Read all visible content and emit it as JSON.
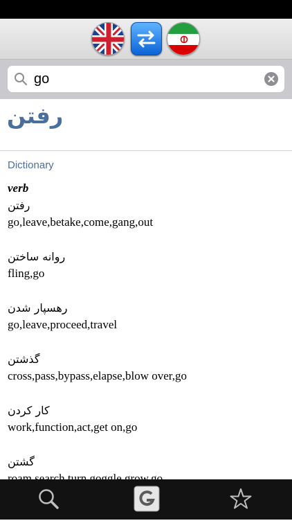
{
  "search": {
    "value": "go"
  },
  "result": {
    "headword": "رفتن",
    "section": "Dictionary",
    "part_of_speech": "verb",
    "entries": [
      {
        "persian": "رفتن",
        "english": "go,leave,betake,come,gang,out"
      },
      {
        "persian": "روانه ساختن",
        "english": "fling,go"
      },
      {
        "persian": "رهسپار شدن",
        "english": "go,leave,proceed,travel"
      },
      {
        "persian": "گذشتن",
        "english": "cross,pass,bypass,elapse,blow over,go"
      },
      {
        "persian": "کار کردن",
        "english": "work,function,act,get on,go"
      },
      {
        "persian": "گشتن",
        "english": "roam,search,turn,goggle,grow,go"
      }
    ]
  },
  "colors": {
    "accent": "#4a6f9d",
    "tab_bar": "#121212",
    "search_bg": "#c9c9ce"
  },
  "icons": {
    "lang_from": "uk-flag-icon",
    "swap": "swap-icon",
    "lang_to": "iran-flag-icon",
    "search": "search-icon",
    "clear": "clear-icon",
    "tab_search": "magnifier-icon",
    "tab_google": "google-icon",
    "tab_favorites": "star-icon"
  }
}
